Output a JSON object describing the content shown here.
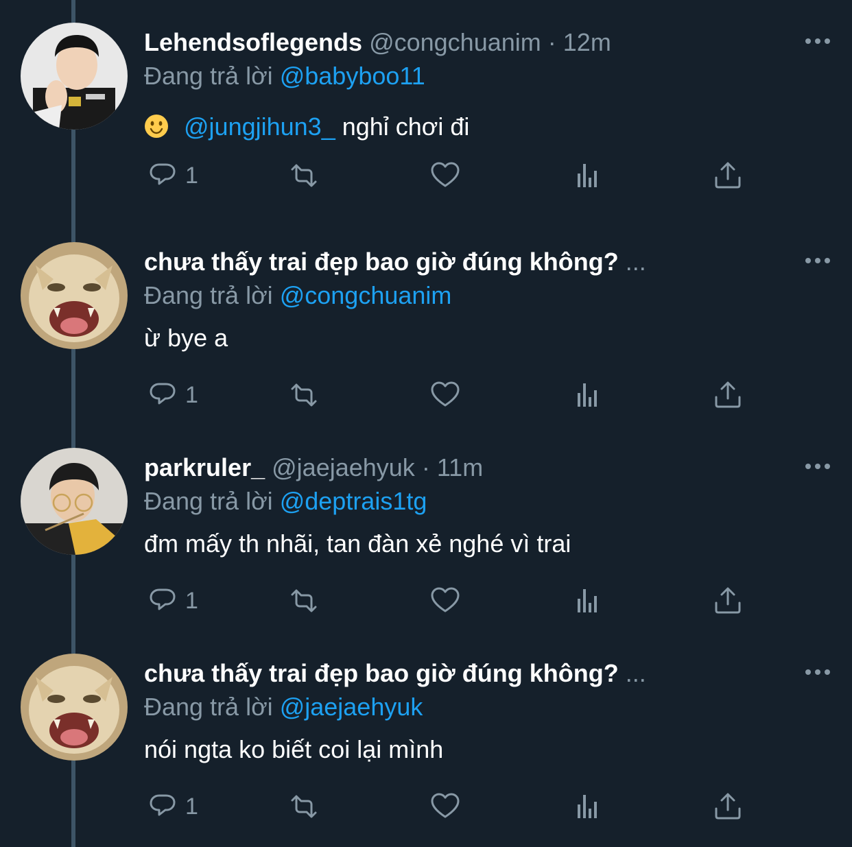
{
  "tweets": [
    {
      "name": "Lehendsoflegends",
      "handle": "@congchuanim",
      "dot": "·",
      "time": "12m",
      "reply_prefix": "Đang trả lời",
      "reply_to": "@babyboo11",
      "emoji": "slightly-smiling-face",
      "mention": "@jungjihun3_",
      "text": " nghỉ chơi đi",
      "reply_count": "1",
      "avatar": "person-photo-avatar"
    },
    {
      "name": "chưa thấy trai đẹp bao giờ đúng không?",
      "truncation": "...",
      "reply_prefix": "Đang trả lời",
      "reply_to": "@congchuanim",
      "text": "ừ bye a",
      "reply_count": "1",
      "avatar": "cat-avatar"
    },
    {
      "name": "parkruler_",
      "handle": "@jaejaehyuk",
      "dot": "·",
      "time": "11m",
      "reply_prefix": "Đang trả lời",
      "reply_to": "@deptrais1tg",
      "text": "đm mấy th nhãi, tan đàn xẻ nghé vì trai",
      "reply_count": "1",
      "avatar": "person-photo-avatar"
    },
    {
      "name": "chưa thấy trai đẹp bao giờ đúng không?",
      "truncation": "...",
      "reply_prefix": "Đang trả lời",
      "reply_to": "@jaejaehyuk",
      "text": "nói ngta ko biết coi lại mình",
      "reply_count": "1",
      "avatar": "cat-avatar"
    }
  ],
  "colors": {
    "background": "#15202b",
    "secondary_text": "#8899a6",
    "link": "#1da1f2",
    "thread_line": "#3d5466"
  }
}
